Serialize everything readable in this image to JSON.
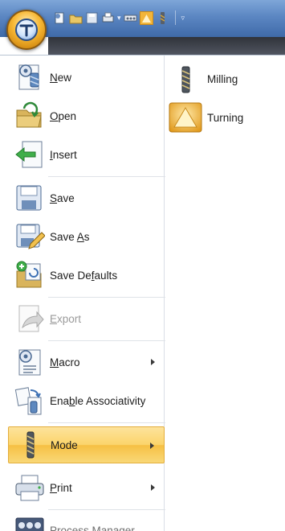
{
  "quick_access": {
    "icons": [
      "new-file-icon",
      "open-folder-icon",
      "save-icon",
      "print-icon",
      "dropdown-arrow-icon",
      "toolbar-icon",
      "turning-mode-icon",
      "milling-tool-icon",
      "customize-icon"
    ]
  },
  "menu": {
    "commands": [
      {
        "name": "new",
        "pre": "",
        "accel": "N",
        "post": "ew",
        "icon": "new-file-icon",
        "enabled": true,
        "submenu": false
      },
      {
        "name": "open",
        "pre": "",
        "accel": "O",
        "post": "pen",
        "icon": "open-folder-icon",
        "enabled": true,
        "submenu": false
      },
      {
        "name": "insert",
        "pre": "",
        "accel": "I",
        "post": "nsert",
        "icon": "insert-icon",
        "enabled": true,
        "submenu": false
      },
      {
        "name": "save",
        "pre": "",
        "accel": "S",
        "post": "ave",
        "icon": "save-icon",
        "enabled": true,
        "submenu": false
      },
      {
        "name": "save-as",
        "pre": "Save ",
        "accel": "A",
        "post": "s",
        "icon": "save-as-icon",
        "enabled": true,
        "submenu": false
      },
      {
        "name": "save-defaults",
        "pre": "Save De",
        "accel": "f",
        "post": "aults",
        "icon": "save-defaults-icon",
        "enabled": true,
        "submenu": false
      },
      {
        "name": "export",
        "pre": "",
        "accel": "E",
        "post": "xport",
        "icon": "export-icon",
        "enabled": false,
        "submenu": false
      },
      {
        "name": "macro",
        "pre": "",
        "accel": "M",
        "post": "acro",
        "icon": "macro-icon",
        "enabled": true,
        "submenu": true
      },
      {
        "name": "enable-associativity",
        "pre": "Ena",
        "accel": "b",
        "post": "le Associativity",
        "icon": "associativity-icon",
        "enabled": true,
        "submenu": false
      },
      {
        "name": "mode",
        "pre": "Mode",
        "accel": "",
        "post": "",
        "icon": "mode-icon",
        "enabled": true,
        "submenu": true,
        "highlighted": true
      },
      {
        "name": "print",
        "pre": "",
        "accel": "P",
        "post": "rint",
        "icon": "print-icon",
        "enabled": true,
        "submenu": true
      },
      {
        "name": "process-manager",
        "pre": "Process Manager",
        "accel": "",
        "post": "",
        "icon": "process-manager-icon",
        "enabled": true,
        "submenu": false
      }
    ],
    "mode_submenu": [
      {
        "label": "Milling",
        "icon": "milling-icon"
      },
      {
        "label": "Turning",
        "icon": "turning-icon"
      }
    ]
  },
  "colors": {
    "title_bar": "#5b86c2",
    "highlight": "#fbd46a",
    "turning_accent": "#f2b53a"
  }
}
